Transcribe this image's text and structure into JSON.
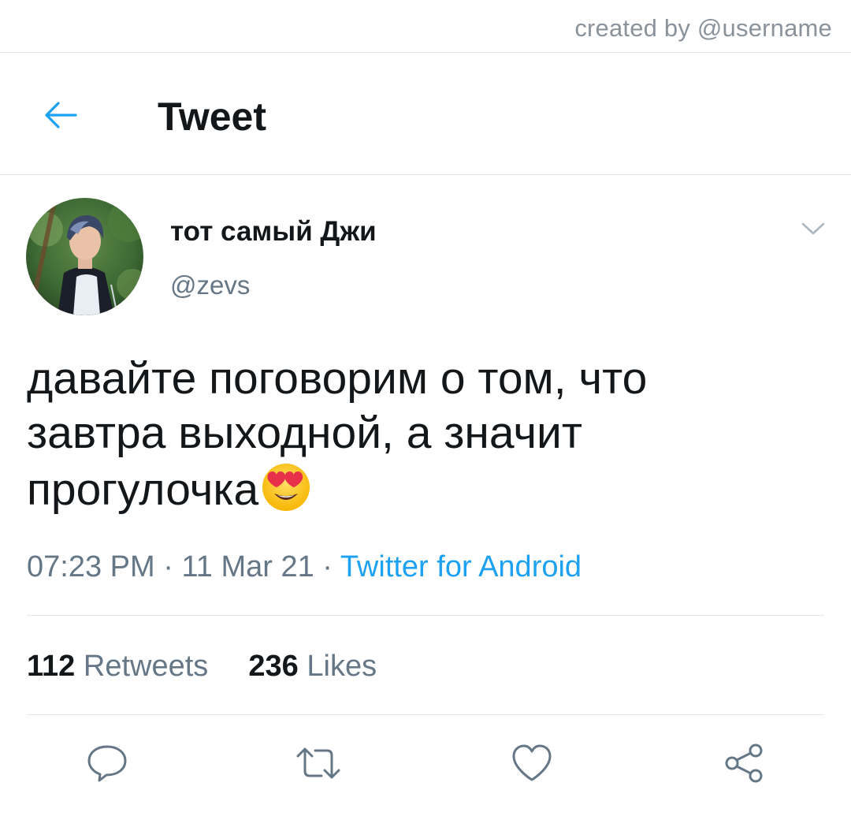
{
  "watermark": "created by @username",
  "header": {
    "title": "Tweet",
    "back_icon": "arrow-left-icon"
  },
  "tweet": {
    "author": {
      "display_name": "тот самый Джи",
      "handle": "@zevs"
    },
    "text_lines": [
      "давайте поговорим о том, что",
      "завтра выходной, а значит",
      "прогулочка"
    ],
    "emoji": "heart-eyes-emoji",
    "meta": {
      "time": "07:23 PM",
      "separator_1": " · ",
      "date": "11 Mar 21",
      "separator_2": " · ",
      "source": "Twitter for Android"
    },
    "stats": {
      "retweets_count": "112",
      "retweets_label": "Retweets",
      "likes_count": "236",
      "likes_label": "Likes"
    }
  },
  "actions": [
    "reply-icon",
    "retweet-icon",
    "like-icon",
    "share-icon"
  ],
  "colors": {
    "accent": "#1da1f2",
    "text_primary": "#14171a",
    "text_secondary": "#657786",
    "divider": "#e3e7ea",
    "icon_gray": "#657786"
  }
}
